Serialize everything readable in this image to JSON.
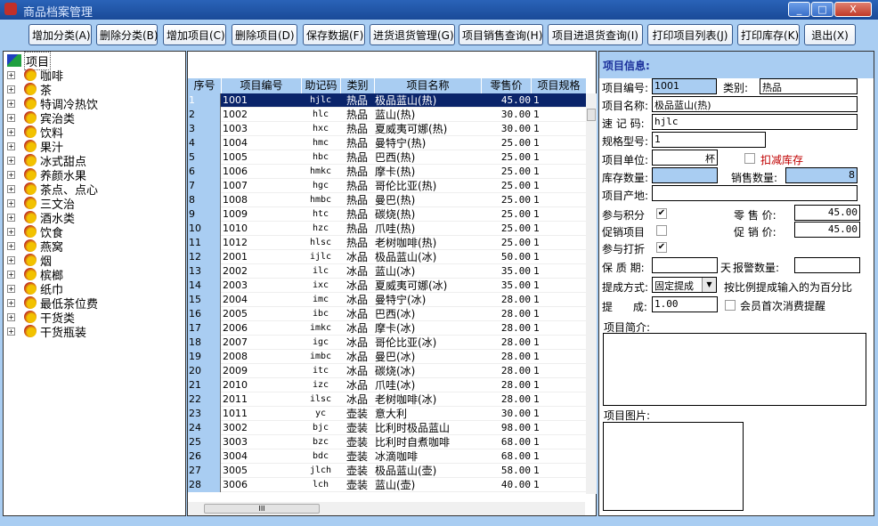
{
  "window": {
    "title": "商品档案管理",
    "min": "_",
    "max": "□",
    "close": "X"
  },
  "toolbar": [
    {
      "label": "增加分类(A)"
    },
    {
      "label": "删除分类(B)"
    },
    {
      "label": "增加项目(C)"
    },
    {
      "label": "删除项目(D)"
    },
    {
      "label": "保存数据(F)"
    },
    {
      "label": "进货退货管理(G)"
    },
    {
      "label": "项目销售查询(H)"
    },
    {
      "label": "项目进退货查询(I)"
    },
    {
      "label": "打印项目列表(J)"
    },
    {
      "label": "打印库存(K)"
    },
    {
      "label": "退出(X)"
    }
  ],
  "tree": {
    "root": "项目",
    "items": [
      "咖啡",
      "茶",
      "特调冷热饮",
      "宾治类",
      "饮料",
      "果汁",
      "冰式甜点",
      "养颜水果",
      "茶点、点心",
      "三文治",
      "酒水类",
      "饮食",
      "燕窝",
      "烟",
      "槟榔",
      "纸巾",
      "最低茶位费",
      "干货类",
      "干货瓶装"
    ]
  },
  "grid": {
    "columns": [
      "序号",
      "项目编号",
      "助记码",
      "类别",
      "项目名称",
      "零售价",
      "项目规格"
    ],
    "selected_row": 1,
    "rows": [
      [
        "1",
        "1001",
        "hjlc",
        "热品",
        "极品蓝山(热)",
        "45.00",
        "1"
      ],
      [
        "2",
        "1002",
        "hlc",
        "热品",
        "蓝山(热)",
        "30.00",
        "1"
      ],
      [
        "3",
        "1003",
        "hxc",
        "热品",
        "夏威夷可娜(热)",
        "30.00",
        "1"
      ],
      [
        "4",
        "1004",
        "hmc",
        "热品",
        "曼特宁(热)",
        "25.00",
        "1"
      ],
      [
        "5",
        "1005",
        "hbc",
        "热品",
        "巴西(热)",
        "25.00",
        "1"
      ],
      [
        "6",
        "1006",
        "hmkc",
        "热品",
        "摩卡(热)",
        "25.00",
        "1"
      ],
      [
        "7",
        "1007",
        "hgc",
        "热品",
        "哥伦比亚(热)",
        "25.00",
        "1"
      ],
      [
        "8",
        "1008",
        "hmbc",
        "热品",
        "曼巴(热)",
        "25.00",
        "1"
      ],
      [
        "9",
        "1009",
        "htc",
        "热品",
        "碳烧(热)",
        "25.00",
        "1"
      ],
      [
        "10",
        "1010",
        "hzc",
        "热品",
        "爪哇(热)",
        "25.00",
        "1"
      ],
      [
        "11",
        "1012",
        "hlsc",
        "热品",
        "老树咖啡(热)",
        "25.00",
        "1"
      ],
      [
        "12",
        "2001",
        "ijlc",
        "冰品",
        "极品蓝山(冰)",
        "50.00",
        "1"
      ],
      [
        "13",
        "2002",
        "ilc",
        "冰品",
        "蓝山(冰)",
        "35.00",
        "1"
      ],
      [
        "14",
        "2003",
        "ixc",
        "冰品",
        "夏威夷可娜(冰)",
        "35.00",
        "1"
      ],
      [
        "15",
        "2004",
        "imc",
        "冰品",
        "曼特宁(冰)",
        "28.00",
        "1"
      ],
      [
        "16",
        "2005",
        "ibc",
        "冰品",
        "巴西(冰)",
        "28.00",
        "1"
      ],
      [
        "17",
        "2006",
        "imkc",
        "冰品",
        "摩卡(冰)",
        "28.00",
        "1"
      ],
      [
        "18",
        "2007",
        "igc",
        "冰品",
        "哥伦比亚(冰)",
        "28.00",
        "1"
      ],
      [
        "19",
        "2008",
        "imbc",
        "冰品",
        "曼巴(冰)",
        "28.00",
        "1"
      ],
      [
        "20",
        "2009",
        "itc",
        "冰品",
        "碳烧(冰)",
        "28.00",
        "1"
      ],
      [
        "21",
        "2010",
        "izc",
        "冰品",
        "爪哇(冰)",
        "28.00",
        "1"
      ],
      [
        "22",
        "2011",
        "ilsc",
        "冰品",
        "老树咖啡(冰)",
        "28.00",
        "1"
      ],
      [
        "23",
        "1011",
        "yc",
        "壶装",
        "意大利",
        "30.00",
        "1"
      ],
      [
        "24",
        "3002",
        "bjc",
        "壶装",
        "比利时极品蓝山",
        "98.00",
        "1"
      ],
      [
        "25",
        "3003",
        "bzc",
        "壶装",
        "比利时自煮咖啡",
        "68.00",
        "1"
      ],
      [
        "26",
        "3004",
        "bdc",
        "壶装",
        "冰滴咖啡",
        "68.00",
        "1"
      ],
      [
        "27",
        "3005",
        "jlch",
        "壶装",
        "极品蓝山(壶)",
        "58.00",
        "1"
      ],
      [
        "28",
        "3006",
        "lch",
        "壶装",
        "蓝山(壶)",
        "40.00",
        "1"
      ]
    ],
    "hscroll_thumb": "III"
  },
  "info": {
    "title": "项目信息:",
    "code_label": "项目编号:",
    "code": "1001",
    "type_label": "类别:",
    "type": "热品",
    "name_label": "项目名称:",
    "name": "极品蓝山(热)",
    "memo_label": "速 记 码:",
    "memo": "hjlc",
    "spec_label": "规格型号:",
    "spec": "1",
    "unit_label": "项目单位:",
    "unit": "杯",
    "deduct_label": "扣减库存",
    "deduct_checked": false,
    "stock_label": "库存数量:",
    "stock": "",
    "sold_label": "销售数量:",
    "sold": "8",
    "origin_label": "项目产地:",
    "origin": "",
    "points_label": "参与积分",
    "points_checked": true,
    "price_label": "零 售 价:",
    "price": "45.00",
    "promo_label": "促销项目",
    "promo_checked": false,
    "promo_price_label": "促 销 价:",
    "promo_price": "45.00",
    "discount_label": "参与打折",
    "discount_checked": true,
    "shelf_label": "保 质 期:",
    "shelf": "",
    "day_label": "天",
    "alarm_label": "报警数量:",
    "alarm": "",
    "comm_mode_label": "提成方式:",
    "comm_mode": "固定提成",
    "comm_hint": "按比例提成输入的为百分比",
    "comm_label": "提      成:",
    "comm": "1.00",
    "remind_label": "会员首次消费提醒",
    "remind_checked": false,
    "intro_label": "项目简介:",
    "intro": "",
    "image_label": "项目图片:"
  },
  "colors": {
    "accent": "#a9cdf2",
    "selection": "#0a246a",
    "title": "#1a4a98",
    "warn": "#c00000"
  }
}
